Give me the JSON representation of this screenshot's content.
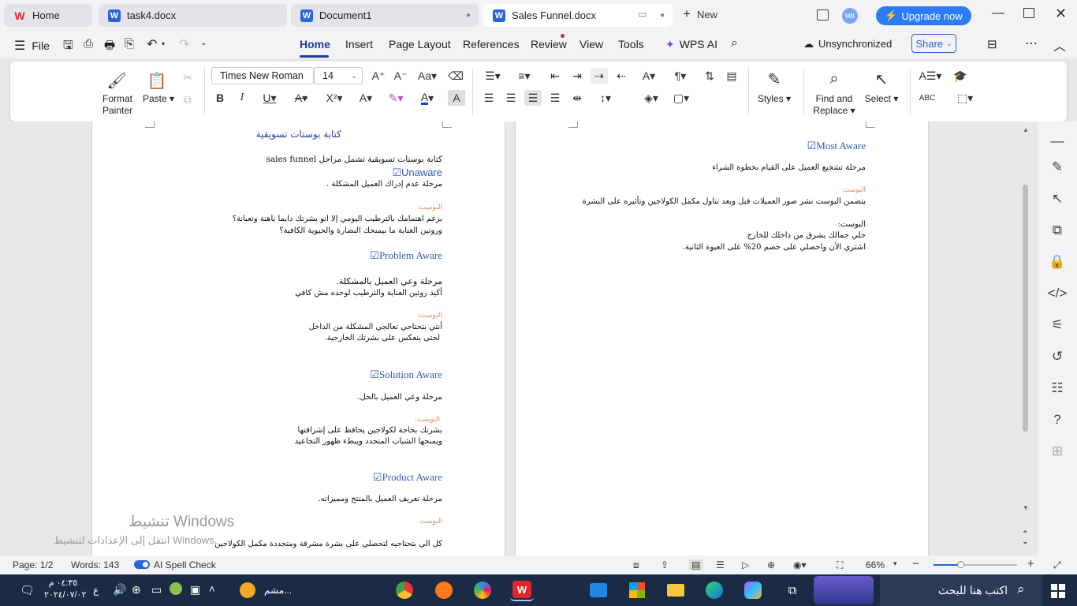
{
  "tabs": [
    {
      "label": "Home"
    },
    {
      "label": "task4.docx"
    },
    {
      "label": "Document1"
    },
    {
      "label": "Sales Funnel.docx"
    }
  ],
  "new_tab": "New",
  "avatar": "MB",
  "upgrade": "Upgrade now",
  "menu": {
    "file": "File",
    "items": [
      "Home",
      "Insert",
      "Page Layout",
      "References",
      "Review",
      "View",
      "Tools"
    ],
    "wps_ai": "WPS AI",
    "sync": "Unsynchronized",
    "share": "Share"
  },
  "ribbon": {
    "format_painter": "Format Painter",
    "format_painter_l1": "Format",
    "format_painter_l2": "Painter",
    "paste": "Paste",
    "font_name": "Times New Roman",
    "font_size": "14",
    "styles": "Styles",
    "find_replace_l1": "Find and",
    "find_replace_l2": "Replace",
    "select": "Select",
    "abc": "ABC"
  },
  "colors": {
    "accent": "#1b3f9b",
    "heading": "#2f5dab",
    "label": "#e08d65",
    "upgrade": "#2b7cf6"
  },
  "doc_left": {
    "title": "كتابة بوستات تسويقية",
    "intro": "كتابة بوستات تسويقية تشمل مراحل sales funnel",
    "s1_head": "Unaware☑",
    "s1_desc": "مرحلة عدم إدراك العميل المشكلة .",
    "s1_label": "البوست:",
    "s1_p1": "برغم اهتمامك بالترطيب اليومي إلا انو بشرتك دايما باهتة وتعبانة؟",
    "s1_p2": "وروتين العناية ما بيمنحك النضارة والحيوية الكافية؟",
    "s2_head": "Problem Aware☑",
    "s2_desc": "مرحلة وعي العميل بالمشكلة.",
    "s2_desc2": "أكيد روتين العناية والترطيب لوحده مش كافي",
    "s2_label": "البوست:",
    "s2_p1": "أنتي بتحتاجي تعالجي المشكلة من الداخل",
    "s2_p2": "لحتى ينعكس على بشرتك الخارجية.",
    "s3_head": "Solution Aware☑",
    "s3_desc": "مرحلة وعي العميل بالحل.",
    "s3_label": "البوست:",
    "s3_p1": "بشرتك بحاجة لكولاجين يحافظ على إشراقتها",
    "s3_p2": "ويمنحها الشباب المتجدد ويبطء ظهور التجاعيد",
    "s4_head": "Product Aware☑",
    "s4_desc": "مرحلة تعريف العميل بالمنتج ومميزاته.",
    "s4_label": "البوست",
    "s4_p1": "كل الي بتحتاجيه لتحصلي على بشرة مشرقة ومتجددة مكمل الكولاجين"
  },
  "doc_right": {
    "s5_head": "Most Aware☑",
    "s5_desc": "مرحلة تشجيع العميل على القيام بخطوة الشراء",
    "s5_label": "البوست",
    "s5_p1": "يتضمن البوست نشر صور العميلات قبل وبعد تناول مكمل الكولاجين وتأثيره على البشرة",
    "s5_label2": "البوست:",
    "s5_p2": "خلي جمالك يشرق من داخلك للخارج",
    "s5_p3": "اشتري الأن واحصلي على خصم 20% على العبوة الثانية."
  },
  "watermark": {
    "title": "تنشيط Windows",
    "sub": "انتقل إلى الإعدادات لتنشيط Windows."
  },
  "status": {
    "page": "Page: 1/2",
    "words": "Words: 143",
    "spell": "AI Spell Check",
    "zoom": "66%"
  },
  "taskbar": {
    "time": "٠٤:٣٥ م",
    "date": "٢٠٢٤/٠٧/٠٢",
    "lang": "ع",
    "search": "اكتب هنا للبحث",
    "app": "مشم..."
  }
}
